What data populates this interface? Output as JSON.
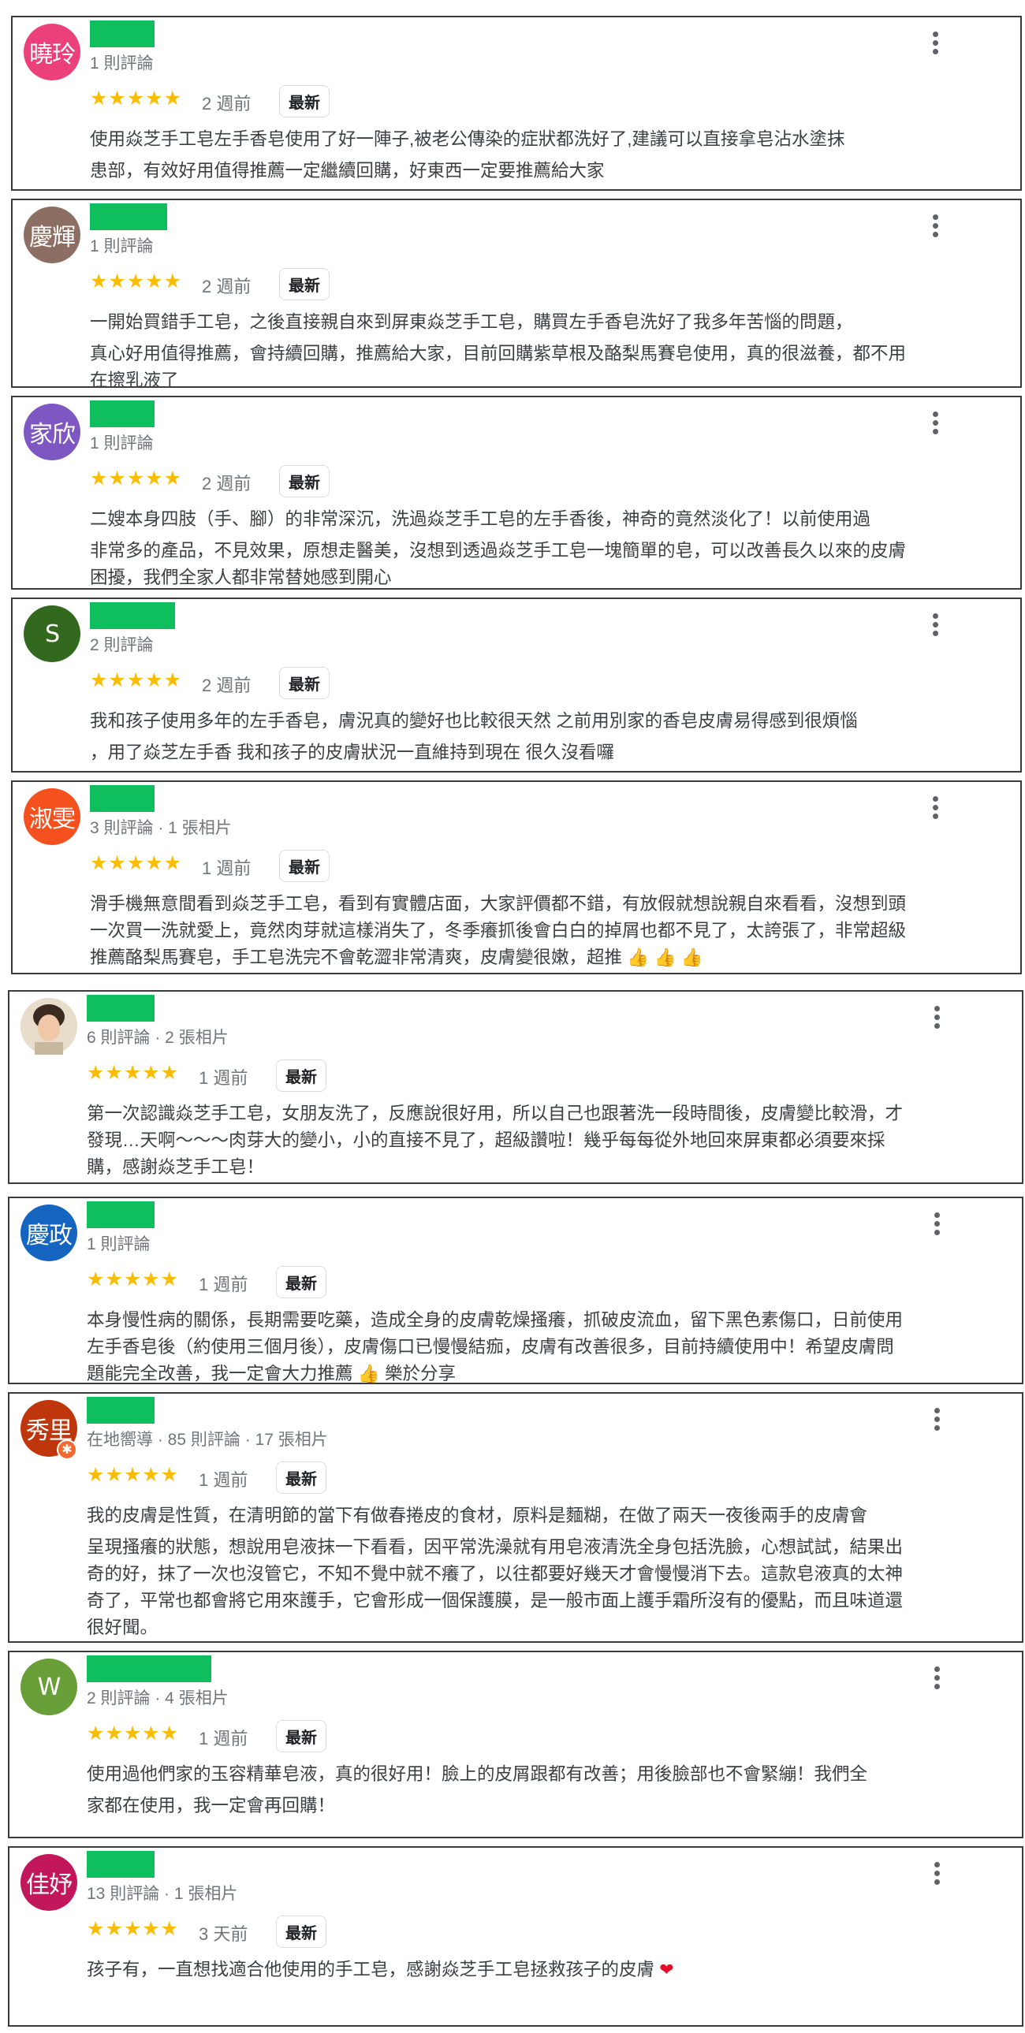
{
  "reviews": [
    {
      "avatar_text": "曉玲",
      "avatar_color": "#ec407a",
      "meta": "1 則評論",
      "stars": "★★★★★",
      "when": "2 週前",
      "badge": "最新",
      "text": [
        [
          "使用焱芝手工皂左手香皂使用了好一陣子,被老公傳染的",
          null,
          "症狀都洗好了,建議可以直接拿皂沾水塗抹"
        ],
        [
          "患部，有效好用值得推薦一定繼續回購，好東西一定要推薦給大家"
        ]
      ]
    },
    {
      "avatar_text": "慶輝",
      "avatar_color": "#8d6e63",
      "meta": "1 則評論",
      "stars": "★★★★★",
      "when": "2 週前",
      "badge": "最新",
      "text": [
        [
          "一開始買錯手工皂，之後直接親自來到屏東焱芝手工皂，購買左手香皂洗好了我多年苦惱的",
          null,
          "問題，"
        ],
        [
          "真心好用值得推薦，會持續回購，推薦給大家，目前回購紫草根及酪梨馬賽皂使用，真的很滋養，都不用"
        ],
        [
          "在擦乳液了"
        ]
      ]
    },
    {
      "avatar_text": "家欣",
      "avatar_color": "#7e57c2",
      "meta": "1 則評論",
      "stars": "★★★★★",
      "when": "2 週前",
      "badge": "最新",
      "text": [
        [
          "二嫂本身四肢（手、腳）的",
          null,
          "非常深沉，洗過焱芝手工皂的左手香後，神奇的竟然淡化了！以前使用過"
        ],
        [
          "非常多的產品，不見效果，原想走醫美，沒想到透過焱芝手工皂一塊簡單的皂，可以改善長久以來的皮膚"
        ],
        [
          "困擾，我們全家人都非常替她感到開心"
        ]
      ]
    },
    {
      "avatar_text": "S",
      "avatar_color": "#33691e",
      "meta": "2 則評論",
      "stars": "★★★★★",
      "when": "2 週前",
      "badge": "最新",
      "text": [
        [
          "我和孩子使用多年的左手香皂，膚況真的變好也比較很天然 之前用別家的香皂皮膚易得",
          null,
          "感到很煩惱"
        ],
        [
          "，用了焱芝左手香 我和孩子的皮膚狀況一直維持到現在 很久沒看",
          null,
          "囉"
        ]
      ]
    },
    {
      "avatar_text": "淑雯",
      "avatar_color": "#f4511e",
      "meta": "3 則評論 · 1 張相片",
      "stars": "★★★★★",
      "when": "1 週前",
      "badge": "最新",
      "text": [
        [
          "滑手機無意間看到焱芝手工皂，看到有實體店面，大家評價都不錯，有放假就想說親自來看看，沒想到頭"
        ],
        [
          "一次買一洗就愛上，竟然肉芽就這樣消失了，冬季癢抓後會白白的掉屑也都不見了，太誇張了，非常超級"
        ],
        [
          "推薦酪梨馬賽皂，手工皂洗完不會乾澀非常清爽，皮膚變很嫩，超推 👍 👍 👍"
        ]
      ]
    },
    {
      "avatar_text": "",
      "avatar_color": "#d9c3a8",
      "meta": "6 則評論 · 2 張相片",
      "stars": "★★★★★",
      "when": "1 週前",
      "badge": "最新",
      "text": [
        [
          "第一次認識焱芝手工皂，女朋友洗了，反應說很好用，所以自己也跟著洗一段時間後，皮膚變比較滑，才"
        ],
        [
          "發現…天啊～～～肉芽大的變小，小的直接不見了，超級讚啦！幾乎每每從外地回來屏東都必須要來採"
        ],
        [
          "購，感謝焱芝手工皂！"
        ]
      ]
    },
    {
      "avatar_text": "慶政",
      "avatar_color": "#1565c0",
      "meta": "1 則評論",
      "stars": "★★★★★",
      "when": "1 週前",
      "badge": "最新",
      "text": [
        [
          "本身慢性病的關係，長期需要吃藥，造成全身的皮膚乾燥搔癢，抓破皮流血，留下黑色素傷口，日前使用"
        ],
        [
          "左手香皂後（約使用三個月後），皮膚傷口已慢慢結痂，皮膚有改善很多，目前持續使用中！希望皮膚問"
        ],
        [
          "題能完全改善，我一定會大力推薦 👍 樂於分享"
        ]
      ]
    },
    {
      "avatar_text": "秀里",
      "avatar_color": "#bf360c",
      "meta": "在地嚮導 · 85 則評論 · 17 張相片",
      "stars": "★★★★★",
      "when": "1 週前",
      "badge": "最新",
      "text": [
        [
          "我的皮膚是",
          null,
          "性質，在清明節的當下有做春捲皮的食材，原料是麵糊，在做了兩天一夜後兩手的皮膚會"
        ],
        [
          "呈現搔癢的狀態，想說用皂液抹一下看看，因平常洗澡就有用皂液清洗全身包括洗臉，心想試試，結果出"
        ],
        [
          "奇的好，抹了一次也沒管它，不知不覺中就不癢了，以往都要好幾天才會慢慢消下去。這款皂液真的太神"
        ],
        [
          "奇了，平常也都會將它用來護手，它會形成一個保護膜，是一般市面上護手霜所沒有的優點，而且味道還"
        ],
        [
          "很好聞。"
        ]
      ]
    },
    {
      "avatar_text": "W",
      "avatar_color": "#689f38",
      "meta": "2 則評論 · 4 張相片",
      "stars": "★★★★★",
      "when": "1 週前",
      "badge": "最新",
      "text": [
        [
          "使用過他們家的玉容精華皂液，真的很好用！臉上的皮屑跟",
          null,
          "都有改善；用後臉部也不會緊繃！我們全"
        ],
        [
          "家都在使用，我一定會再回購！"
        ]
      ]
    },
    {
      "avatar_text": "佳妤",
      "avatar_color": "#c2185b",
      "meta": "13 則評論 · 1 張相片",
      "stars": "★★★★★",
      "when": "3 天前",
      "badge": "最新",
      "text": [
        [
          "孩子有",
          null,
          "，一直想找適合他使用的手工皂，感謝焱芝手工皂拯救孩子的皮膚 ❤"
        ]
      ]
    }
  ],
  "icons": {
    "more": "more-vert-icon",
    "star": "star-icon",
    "thumbs_up": "thumbs-up-icon",
    "heart": "heart-icon",
    "local_guide": "local-guide-badge-icon"
  },
  "colors": {
    "star": "#fbbc04",
    "redaction": "#0fbf5e",
    "border": "#3c3c3c",
    "meta_text": "#70757a"
  }
}
